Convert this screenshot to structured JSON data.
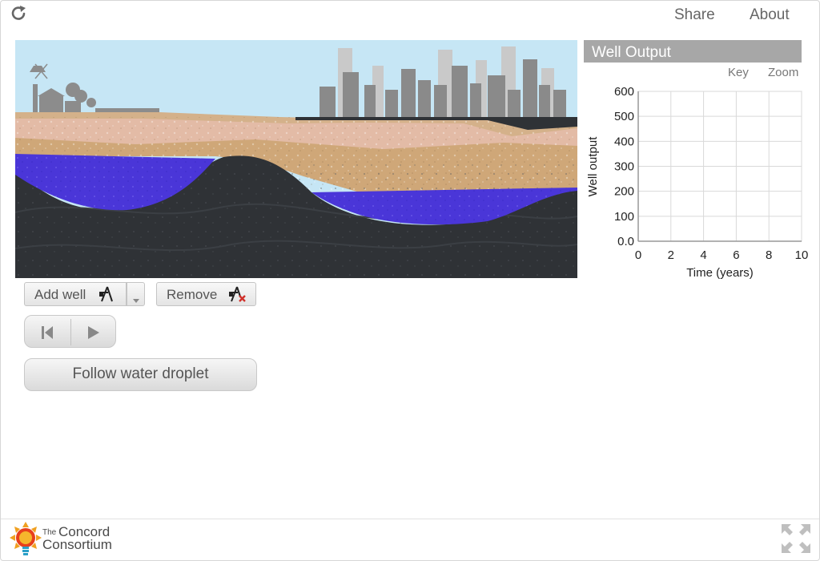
{
  "header": {
    "reload_icon": "reload-icon",
    "share_label": "Share",
    "about_label": "About"
  },
  "graph": {
    "title": "Well Output",
    "key_label": "Key",
    "zoom_label": "Zoom",
    "y_axis_label": "Well output",
    "x_axis_label": "Time (years)",
    "y_ticks": [
      "600",
      "500",
      "400",
      "300",
      "200",
      "100",
      "0.0"
    ],
    "x_ticks": [
      "0",
      "2",
      "4",
      "6",
      "8",
      "10"
    ]
  },
  "controls": {
    "add_well_label": "Add well",
    "remove_label": "Remove",
    "follow_droplet_label": "Follow water droplet"
  },
  "footer": {
    "logo_line1_small": "The",
    "logo_line1": "Concord",
    "logo_line2": "Consortium"
  },
  "colors": {
    "sky": "#c6e6f5",
    "sand_pink": "#e3bba6",
    "sand_tan": "#cfa778",
    "water": "#4a36d8",
    "rock": "#2f3236",
    "city": "#8a8a8a",
    "panel_title_bg": "#a7a7a7"
  }
}
